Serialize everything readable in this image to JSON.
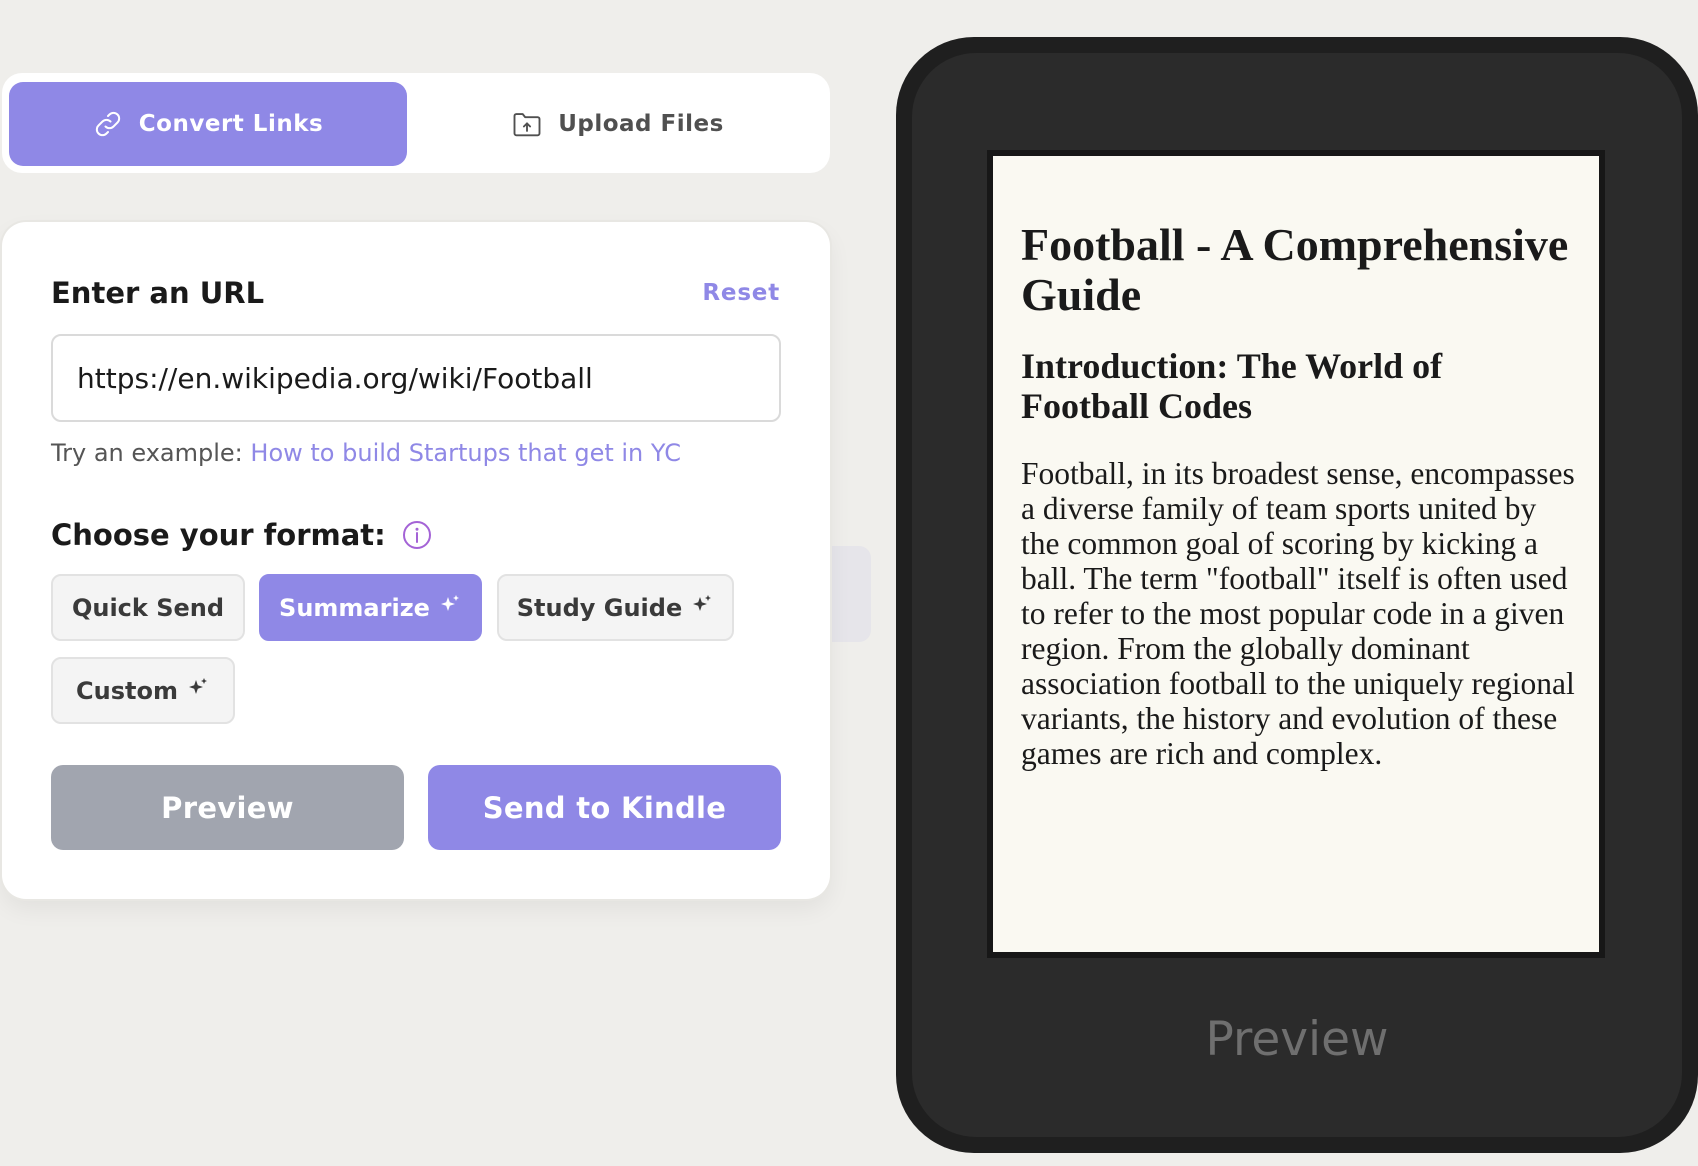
{
  "tabs": {
    "convert_links": "Convert Links",
    "upload_files": "Upload Files"
  },
  "form": {
    "url_label": "Enter an URL",
    "reset_label": "Reset",
    "url_value": "https://en.wikipedia.org/wiki/Football",
    "example_prefix": "Try an example:",
    "example_link": "How to build Startups that get in YC",
    "format_label": "Choose your format:",
    "formats": [
      {
        "label": "Quick Send",
        "selected": false,
        "sparkle": false
      },
      {
        "label": "Summarize",
        "selected": true,
        "sparkle": true
      },
      {
        "label": "Study Guide",
        "selected": false,
        "sparkle": true
      },
      {
        "label": "Custom",
        "selected": false,
        "sparkle": true
      }
    ],
    "preview_button": "Preview",
    "send_button": "Send to Kindle"
  },
  "kindle": {
    "title": "Football - A Comprehensive Guide",
    "heading": "Introduction: The World of Football Codes",
    "paragraph": "Football, in its broadest sense, encompasses a diverse family of team sports united by the common goal of scoring by kicking a ball. The term \"football\" itself is often used to refer to the most popular code in a given region. From the globally dominant association football to the uniquely regional variants, the history and evolution of these games are rich and complex.",
    "caption": "Preview"
  },
  "colors": {
    "accent": "#8F88E6",
    "background": "#EFEEEB",
    "device": "#1F1F1F",
    "screen": "#FAF9F2",
    "preview_button": "#A1A5AF"
  },
  "icons": {
    "convert_tab": "link-icon",
    "upload_tab": "folder-upload-icon",
    "format_info": "info-icon",
    "format_ai": "sparkle-icon"
  }
}
